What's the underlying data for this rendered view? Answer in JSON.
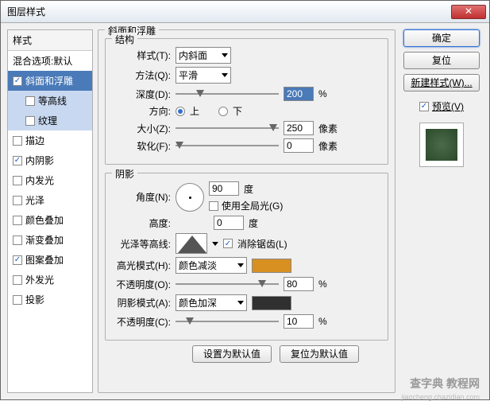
{
  "window": {
    "title": "图层样式"
  },
  "sidebar": {
    "header": "样式",
    "blend": "混合选项:默认",
    "items": [
      {
        "label": "斜面和浮雕",
        "checked": true,
        "selected": true
      },
      {
        "label": "等高线",
        "checked": false,
        "sub": true,
        "hilite": true
      },
      {
        "label": "纹理",
        "checked": false,
        "sub": true,
        "hilite": true
      },
      {
        "label": "描边",
        "checked": false
      },
      {
        "label": "内阴影",
        "checked": true
      },
      {
        "label": "内发光",
        "checked": false
      },
      {
        "label": "光泽",
        "checked": false
      },
      {
        "label": "颜色叠加",
        "checked": false
      },
      {
        "label": "渐变叠加",
        "checked": false
      },
      {
        "label": "图案叠加",
        "checked": true
      },
      {
        "label": "外发光",
        "checked": false
      },
      {
        "label": "投影",
        "checked": false
      }
    ]
  },
  "panel": {
    "title": "斜面和浮雕",
    "structure": {
      "legend": "结构",
      "style_lbl": "样式(T):",
      "style_val": "内斜面",
      "method_lbl": "方法(Q):",
      "method_val": "平滑",
      "depth_lbl": "深度(D):",
      "depth_val": "200",
      "depth_unit": "%",
      "dir_lbl": "方向:",
      "up": "上",
      "down": "下",
      "size_lbl": "大小(Z):",
      "size_val": "250",
      "size_unit": "像素",
      "soft_lbl": "软化(F):",
      "soft_val": "0",
      "soft_unit": "像素"
    },
    "shading": {
      "legend": "阴影",
      "angle_lbl": "角度(N):",
      "angle_val": "90",
      "angle_unit": "度",
      "global_lbl": "使用全局光(G)",
      "alt_lbl": "高度:",
      "alt_val": "0",
      "alt_unit": "度",
      "gloss_lbl": "光泽等高线:",
      "aa_lbl": "消除锯齿(L)",
      "hmode_lbl": "高光模式(H):",
      "hmode_val": "颜色减淡",
      "hcolor": "#d89020",
      "hopacity_lbl": "不透明度(O):",
      "hopacity_val": "80",
      "pct": "%",
      "smode_lbl": "阴影模式(A):",
      "smode_val": "颜色加深",
      "scolor": "#303030",
      "sopacity_lbl": "不透明度(C):",
      "sopacity_val": "10"
    },
    "btn_default": "设置为默认值",
    "btn_reset": "复位为默认值"
  },
  "right": {
    "ok": "确定",
    "cancel": "复位",
    "newstyle": "新建样式(W)...",
    "preview_lbl": "预览(V)"
  },
  "watermark": {
    "main": "查字典 教程网",
    "sub": "jiaocheng.chazidian.com"
  }
}
